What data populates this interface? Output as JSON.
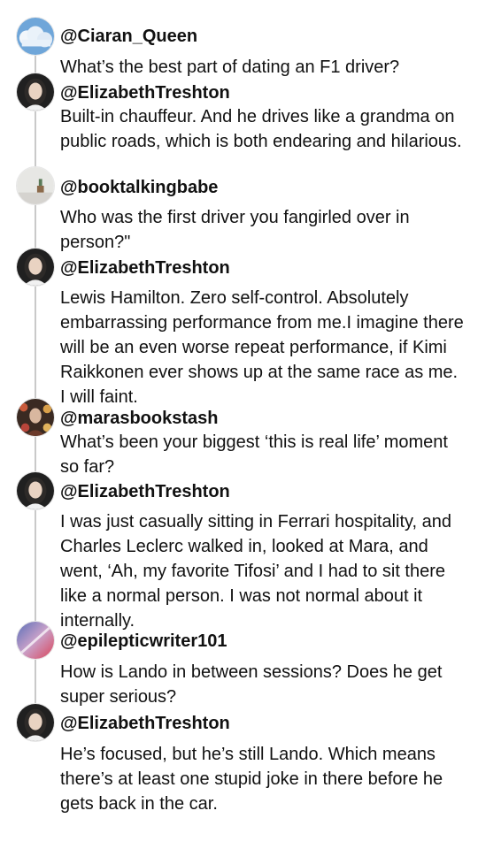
{
  "thread": [
    {
      "handle": "@Ciaran_Queen",
      "text": "What’s the best part of dating an F1 driver?",
      "avatar_icon": "sky-clouds-avatar"
    },
    {
      "handle": "@ElizabethTreshton",
      "text": "Built-in chauffeur. And he drives like a grandma on public roads, which is both endearing and hilarious.",
      "avatar_icon": "portrait-woman-avatar"
    },
    {
      "handle": "@booktalkingbabe",
      "text": "Who was the first driver you fangirled over in person?\"",
      "avatar_icon": "room-interior-avatar"
    },
    {
      "handle": "@ElizabethTreshton",
      "text": "Lewis Hamilton. Zero self-control. Absolutely embarrassing performance from me.I imagine there will be an even worse repeat performance, if Kimi Raikkonen ever shows up at the same race as me. I will faint.",
      "avatar_icon": "portrait-woman-avatar"
    },
    {
      "handle": "@marasbookstash",
      "text": "What’s been your biggest ‘this is real life’ moment so far?",
      "avatar_icon": "woman-flowers-avatar"
    },
    {
      "handle": "@ElizabethTreshton",
      "text": " I was just casually sitting in Ferrari hospitality, and Charles Leclerc walked in, looked at Mara, and went, ‘Ah, my favorite Tifosi’ and I had to sit there like a normal person. I was not normal about it internally.",
      "avatar_icon": "portrait-woman-avatar"
    },
    {
      "handle": "@epilepticwriter101",
      "text": "How is Lando in between sessions? Does he get super serious?",
      "avatar_icon": "gradient-light-avatar"
    },
    {
      "handle": "@ElizabethTreshton",
      "text": "He’s focused, but he’s still Lando. Which means there’s at least one stupid joke in there before he gets back in the car.",
      "avatar_icon": "portrait-woman-avatar"
    }
  ]
}
